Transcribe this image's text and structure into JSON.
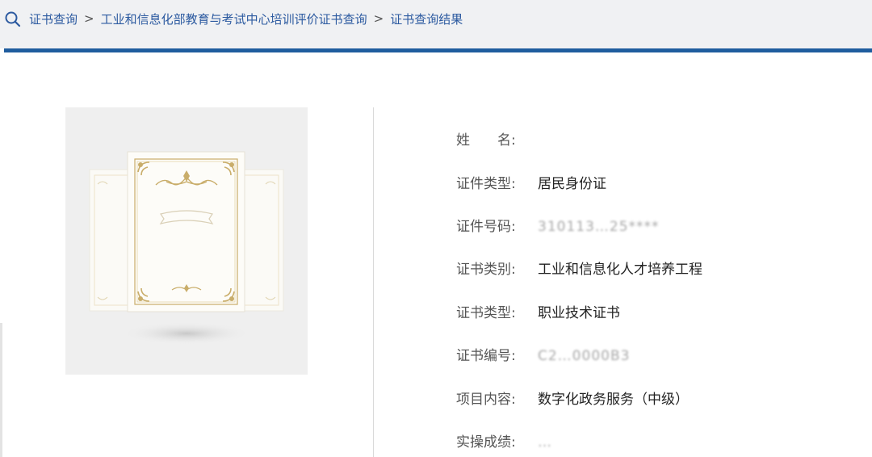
{
  "breadcrumb": {
    "items": [
      "证书查询",
      "工业和信息化部教育与考试中心培训评价证书查询",
      "证书查询结果"
    ],
    "separator": ">"
  },
  "fields": [
    {
      "label": "姓　　名:",
      "value": ""
    },
    {
      "label": "证件类型:",
      "value": "居民身份证"
    },
    {
      "label": "证件号码:",
      "value": "310113…25****"
    },
    {
      "label": "证书类别:",
      "value": "工业和信息化人才培养工程"
    },
    {
      "label": "证书类型:",
      "value": "职业技术证书"
    },
    {
      "label": "证书编号:",
      "value": "C2…0000B3"
    },
    {
      "label": "项目内容:",
      "value": "数字化政务服务（中级）"
    },
    {
      "label": "实操成绩:",
      "value": "…"
    }
  ],
  "colors": {
    "accent": "#1f5d9e",
    "link": "#2c5aa0",
    "topbar": "#f0f1f3",
    "ornament": "#c9ad6a"
  },
  "icons": {
    "search": "search-icon",
    "certificate": "certificate-illustration"
  }
}
